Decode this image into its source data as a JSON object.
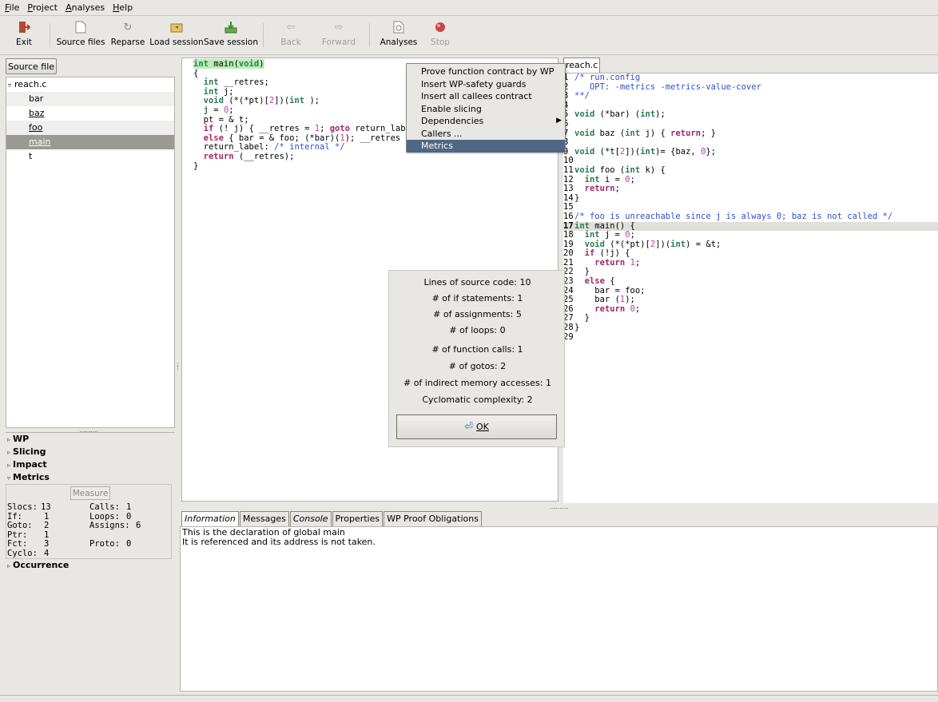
{
  "menu": [
    {
      "label": "File",
      "mnemonic": "F",
      "rest": "ile"
    },
    {
      "label": "Project",
      "mnemonic": "P",
      "rest": "roject"
    },
    {
      "label": "Analyses",
      "mnemonic": "A",
      "rest": "nalyses"
    },
    {
      "label": "Help",
      "mnemonic": "H",
      "rest": "elp"
    }
  ],
  "toolbar": {
    "exit": "Exit",
    "source_files": "Source files",
    "reparse": "Reparse",
    "load_session": "Load session",
    "save_session": "Save session",
    "back": "Back",
    "forward": "Forward",
    "analyses": "Analyses",
    "stop": "Stop"
  },
  "left": {
    "source_file_button": "Source file",
    "file": "reach.c",
    "functions": [
      "bar",
      "baz",
      "foo",
      "main",
      "t"
    ]
  },
  "plugins": {
    "wp": "WP",
    "slicing": "Slicing",
    "impact": "Impact",
    "metrics": "Metrics",
    "occurrence": "Occurrence",
    "measure": "Measure",
    "stats": {
      "slocs_label": "Slocs:",
      "slocs": "13",
      "if_label": "If:",
      "if": "1",
      "goto_label": "Goto:",
      "goto": "2",
      "ptr_label": "Ptr:",
      "ptr": "1",
      "fct_label": "Fct:",
      "fct": "3",
      "cyclo_label": "Cyclo:",
      "cyclo": "4",
      "calls_label": "Calls:",
      "calls": "1",
      "loops_label": "Loops:",
      "loops": "0",
      "assigns_label": "Assigns:",
      "assigns": "6",
      "proto_label": "Proto:",
      "proto": "0"
    }
  },
  "context_menu": {
    "items": [
      "Prove function contract by WP",
      "Insert WP-safety guards",
      "Insert all callees contract",
      "Enable slicing",
      "Dependencies",
      "Callers ...",
      "Metrics"
    ]
  },
  "metrics_dialog": {
    "lines": [
      "Lines of source code: 10",
      "# of if statements: 1",
      "# of assignments: 5",
      "# of loops: 0",
      "# of function calls: 1",
      "# of gotos: 2",
      "# of indirect memory accesses: 1",
      "Cyclomatic complexity: 2"
    ],
    "ok": "OK"
  },
  "right": {
    "tab": "reach.c"
  },
  "bottom": {
    "tabs": [
      "Information",
      "Messages",
      "Console",
      "Properties",
      "WP Proof Obligations"
    ],
    "info_lines": [
      "This is the declaration of global main",
      "It is referenced and its address is not taken."
    ]
  },
  "colors": {
    "menu_highlight": "#4f6783",
    "keyword": "#a0286a",
    "type": "#2e7a50",
    "number": "#c83c9e",
    "comment": "#2f4fd0"
  }
}
